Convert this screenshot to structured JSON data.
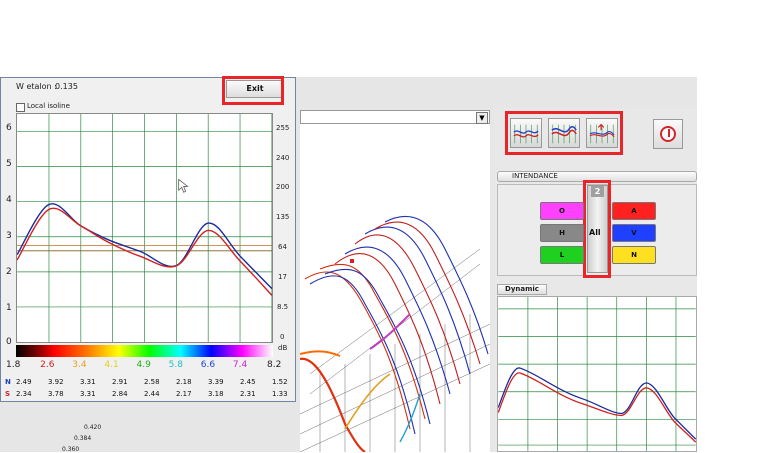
{
  "popup": {
    "w_etalon_label": "W etalon :",
    "w_etalon_value": "0.135",
    "exit_label": "Exit",
    "local_isoline_label": "Local isoline",
    "y_ticks": [
      "6",
      "5",
      "4",
      "3",
      "2",
      "1",
      "0"
    ],
    "right_ticks": [
      "255",
      "240",
      "200",
      "135",
      "64",
      "17",
      "8.5",
      "0"
    ],
    "right_unit": "dB",
    "gradient_ticks": [
      "1.8",
      "2.6",
      "3.4",
      "4.1",
      "4.9",
      "5.8",
      "6.6",
      "7.4",
      "8.2"
    ],
    "gradient_tick_colors": [
      "#222222",
      "#d42020",
      "#e8a020",
      "#e0d020",
      "#20b020",
      "#20c0c0",
      "#2040e0",
      "#d020d0",
      "#222222"
    ],
    "rows": [
      {
        "label": "N",
        "values": [
          "2.49",
          "3.92",
          "3.31",
          "2.91",
          "2.58",
          "2.18",
          "3.39",
          "2.45",
          "1.52"
        ],
        "label_color": "#2040c0"
      },
      {
        "label": "S",
        "values": [
          "2.34",
          "3.78",
          "3.31",
          "2.84",
          "2.44",
          "2.17",
          "3.18",
          "2.31",
          "1.33"
        ],
        "label_color": "#d02020"
      }
    ]
  },
  "main_view": {
    "axis_labels": [
      "0.420",
      "0.384",
      "0.360"
    ]
  },
  "intendance": {
    "title": "INTENDANCE",
    "count_badge": "2",
    "all_label": "All",
    "buttons": [
      {
        "label": "O",
        "color": "#ff40ff"
      },
      {
        "label": "A",
        "color": "#ff2020"
      },
      {
        "label": "H",
        "color": "#888888"
      },
      {
        "label": "V",
        "color": "#2040ff"
      },
      {
        "label": "L",
        "color": "#20d020"
      },
      {
        "label": "N",
        "color": "#ffe020"
      }
    ]
  },
  "dynamic": {
    "title": "Dynamic"
  },
  "colors": {
    "highlight": "#e8262a",
    "series_n": "#1a2a9a",
    "series_s": "#d02020"
  },
  "chart_data": {
    "type": "line",
    "x": [
      1.8,
      2.6,
      3.4,
      4.1,
      4.9,
      5.8,
      6.6,
      7.4,
      8.2
    ],
    "series": [
      {
        "name": "N",
        "values": [
          2.49,
          3.92,
          3.31,
          2.91,
          2.58,
          2.18,
          3.39,
          2.45,
          1.52
        ]
      },
      {
        "name": "S",
        "values": [
          2.34,
          3.78,
          3.31,
          2.84,
          2.44,
          2.17,
          3.18,
          2.31,
          1.33
        ]
      }
    ],
    "ylim": [
      0,
      6.5
    ],
    "grid": true
  }
}
